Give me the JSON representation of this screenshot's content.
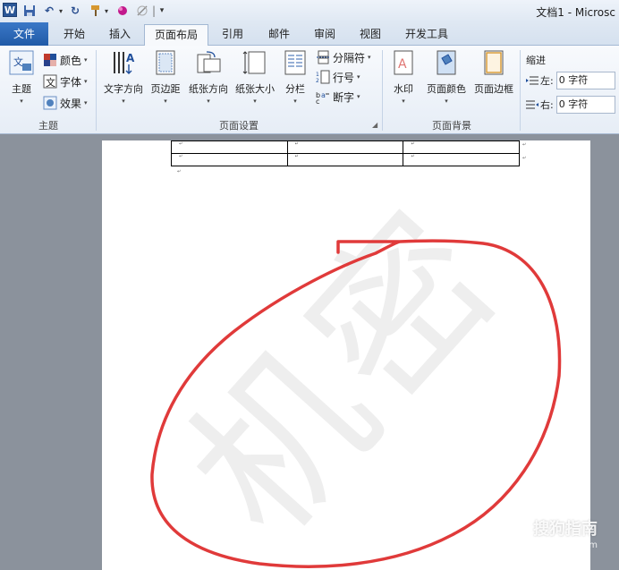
{
  "quick_access": {
    "word_icon": "W",
    "separator": "|"
  },
  "window": {
    "title": "文档1 - Microsc"
  },
  "tabs": [
    {
      "label": "文件",
      "active": false
    },
    {
      "label": "开始",
      "active": false
    },
    {
      "label": "插入",
      "active": false
    },
    {
      "label": "页面布局",
      "active": true
    },
    {
      "label": "引用",
      "active": false
    },
    {
      "label": "邮件",
      "active": false
    },
    {
      "label": "审阅",
      "active": false
    },
    {
      "label": "视图",
      "active": false
    },
    {
      "label": "开发工具",
      "active": false
    }
  ],
  "ribbon": {
    "theme_group": {
      "label": "主题",
      "theme_button": "主题",
      "colors": "颜色",
      "fonts": "字体",
      "effects": "效果"
    },
    "page_setup_group": {
      "label": "页面设置",
      "text_direction": "文字方向",
      "margins": "页边距",
      "orientation": "纸张方向",
      "size": "纸张大小",
      "columns": "分栏",
      "breaks": "分隔符",
      "line_numbers": "行号",
      "hyphenation": "断字"
    },
    "page_background_group": {
      "label": "页面背景",
      "watermark": "水印",
      "page_color": "页面颜色",
      "page_borders": "页面边框"
    },
    "paragraph_group": {
      "indent_label": "缩进",
      "left_label": "左:",
      "left_value": "0 字符",
      "right_label": "右:",
      "right_value": "0 字符"
    }
  },
  "document": {
    "watermark_text": "机密",
    "cell_mark": "↵",
    "table_rows": [
      [
        "↵",
        "↵",
        "↵"
      ],
      [
        "↵",
        "↵",
        "↵"
      ]
    ]
  },
  "site_watermark": {
    "name": "搜狗指南",
    "url": "zhinan.sogou.com"
  },
  "colors": {
    "file_tab": "#2b5fa8",
    "annotation": "#e03a3a"
  }
}
